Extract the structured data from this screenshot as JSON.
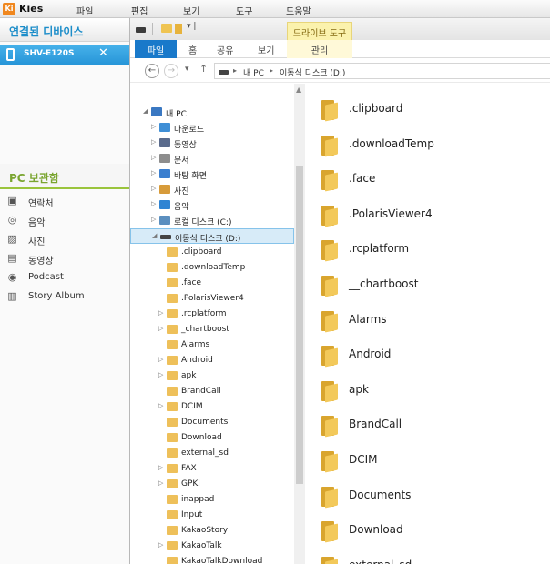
{
  "kies": {
    "logo": "Ki",
    "title": "Kies",
    "menu": [
      "파일",
      "편집",
      "보기",
      "도구",
      "도움말"
    ]
  },
  "sidebar": {
    "connected_header": "연결된 디바이스",
    "device_name": "SHV-E120S",
    "device_close": "✕",
    "pc_header": "PC 보관함",
    "items": [
      {
        "label": "연락처",
        "icon": "contacts-icon"
      },
      {
        "label": "음악",
        "icon": "music-icon"
      },
      {
        "label": "사진",
        "icon": "photo-icon"
      },
      {
        "label": "동영상",
        "icon": "video-icon"
      },
      {
        "label": "Podcast",
        "icon": "podcast-icon"
      },
      {
        "label": "Story Album",
        "icon": "story-album-icon"
      }
    ]
  },
  "explorer": {
    "qat_down": "▾ |",
    "context_tab_group": "드라이브 도구",
    "ribbon_tabs": [
      "파일",
      "홈",
      "공유",
      "보기"
    ],
    "context_tab": "관리",
    "address": [
      "내 PC",
      "이동식 디스크 (D:)"
    ],
    "nav": {
      "back": "←",
      "forward": "→",
      "recent": "▾",
      "up": "↑"
    },
    "tree": [
      {
        "label": "내 PC",
        "level": 0,
        "arrow": "◢",
        "icon": "pc"
      },
      {
        "label": "다운로드",
        "level": 1,
        "arrow": "▷",
        "icon": "download"
      },
      {
        "label": "동영상",
        "level": 1,
        "arrow": "▷",
        "icon": "video"
      },
      {
        "label": "문서",
        "level": 1,
        "arrow": "▷",
        "icon": "doc"
      },
      {
        "label": "바탕 화면",
        "level": 1,
        "arrow": "▷",
        "icon": "desktop"
      },
      {
        "label": "사진",
        "level": 1,
        "arrow": "▷",
        "icon": "photo"
      },
      {
        "label": "음악",
        "level": 1,
        "arrow": "▷",
        "icon": "music"
      },
      {
        "label": "로컬 디스크 (C:)",
        "level": 1,
        "arrow": "▷",
        "icon": "disk"
      },
      {
        "label": "이동식 디스크 (D:)",
        "level": 1,
        "arrow": "◢",
        "icon": "usb",
        "selected": true
      },
      {
        "label": ".clipboard",
        "level": 2,
        "arrow": "",
        "icon": "folder"
      },
      {
        "label": ".downloadTemp",
        "level": 2,
        "arrow": "",
        "icon": "folder"
      },
      {
        "label": ".face",
        "level": 2,
        "arrow": "",
        "icon": "folder"
      },
      {
        "label": ".PolarisViewer4",
        "level": 2,
        "arrow": "",
        "icon": "folder"
      },
      {
        "label": ".rcplatform",
        "level": 2,
        "arrow": "▷",
        "icon": "folder"
      },
      {
        "label": "_chartboost",
        "level": 2,
        "arrow": "▷",
        "icon": "folder"
      },
      {
        "label": "Alarms",
        "level": 2,
        "arrow": "",
        "icon": "folder"
      },
      {
        "label": "Android",
        "level": 2,
        "arrow": "▷",
        "icon": "folder"
      },
      {
        "label": "apk",
        "level": 2,
        "arrow": "▷",
        "icon": "folder"
      },
      {
        "label": "BrandCall",
        "level": 2,
        "arrow": "",
        "icon": "folder"
      },
      {
        "label": "DCIM",
        "level": 2,
        "arrow": "▷",
        "icon": "folder"
      },
      {
        "label": "Documents",
        "level": 2,
        "arrow": "",
        "icon": "folder"
      },
      {
        "label": "Download",
        "level": 2,
        "arrow": "",
        "icon": "folder"
      },
      {
        "label": "external_sd",
        "level": 2,
        "arrow": "",
        "icon": "folder"
      },
      {
        "label": "FAX",
        "level": 2,
        "arrow": "▷",
        "icon": "folder"
      },
      {
        "label": "GPKI",
        "level": 2,
        "arrow": "▷",
        "icon": "folder"
      },
      {
        "label": "inappad",
        "level": 2,
        "arrow": "",
        "icon": "folder"
      },
      {
        "label": "Input",
        "level": 2,
        "arrow": "",
        "icon": "folder"
      },
      {
        "label": "KakaoStory",
        "level": 2,
        "arrow": "",
        "icon": "folder"
      },
      {
        "label": "KakaoTalk",
        "level": 2,
        "arrow": "▷",
        "icon": "folder"
      },
      {
        "label": "KakaoTalkDownload",
        "level": 2,
        "arrow": "",
        "icon": "folder"
      }
    ],
    "content": [
      ".clipboard",
      ".downloadTemp",
      ".face",
      ".PolarisViewer4",
      ".rcplatform",
      "__chartboost",
      "Alarms",
      "Android",
      "apk",
      "BrandCall",
      "DCIM",
      "Documents",
      "Download",
      "external_sd"
    ],
    "scroll_up": "▲"
  },
  "colors": {
    "accent_blue": "#2795d8",
    "pc_green": "#7aa530",
    "folder_yellow": "#f3c95a",
    "ribbon_file": "#1979ca"
  }
}
